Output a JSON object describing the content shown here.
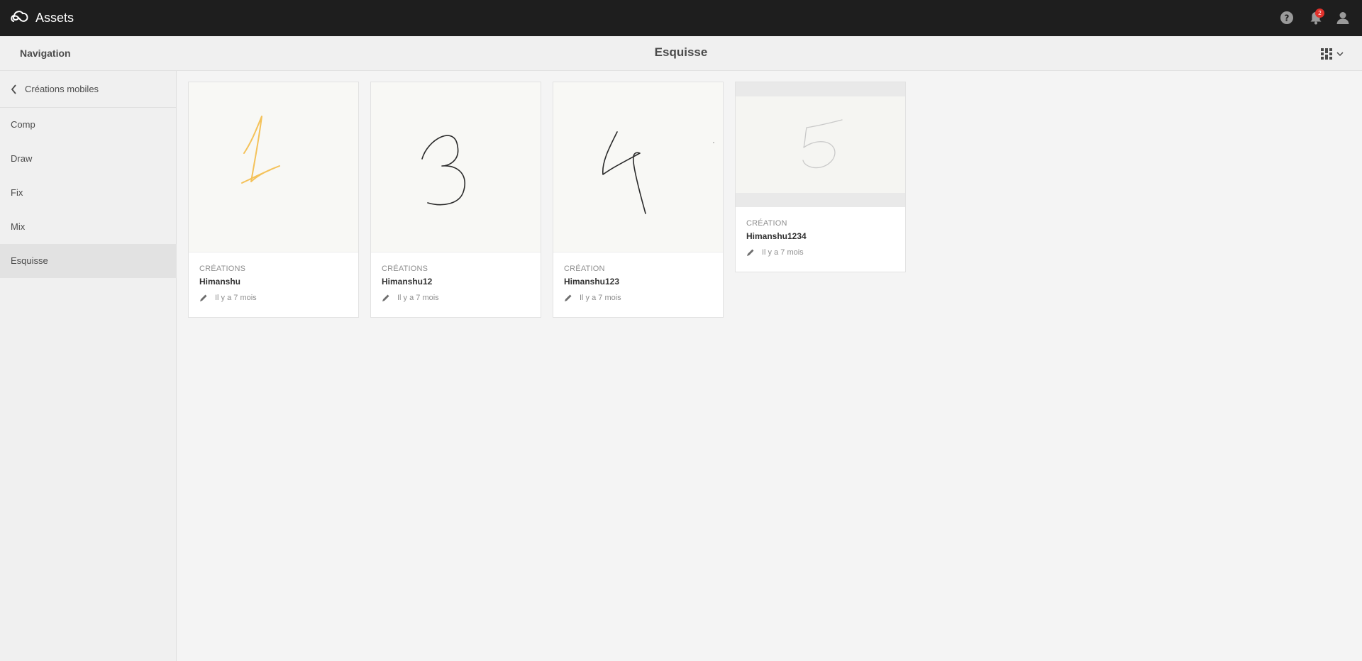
{
  "app": {
    "title": "Assets",
    "notification_count": "2"
  },
  "header": {
    "nav_title": "Navigation",
    "page_title": "Esquisse"
  },
  "sidebar": {
    "back_label": "Créations mobiles",
    "items": [
      {
        "label": "Comp"
      },
      {
        "label": "Draw"
      },
      {
        "label": "Fix"
      },
      {
        "label": "Mix"
      },
      {
        "label": "Esquisse",
        "active": true
      }
    ]
  },
  "cards": [
    {
      "kind": "CRÉATIONS",
      "name": "Himanshu",
      "time": "Il y a 7 mois",
      "sketch": "1",
      "stroke_color": "#f4c25a"
    },
    {
      "kind": "CRÉATIONS",
      "name": "Himanshu12",
      "time": "Il y a 7 mois",
      "sketch": "3",
      "stroke_color": "#2a2a2a"
    },
    {
      "kind": "CRÉATION",
      "name": "Himanshu123",
      "time": "Il y a 7 mois",
      "sketch": "4",
      "stroke_color": "#2a2a2a"
    },
    {
      "kind": "CRÉATION",
      "name": "Himanshu1234",
      "time": "Il y a 7 mois",
      "sketch": "5",
      "stroke_color": "#c9c9c9"
    }
  ],
  "icons": {
    "logo": "creative-cloud-icon",
    "help": "help-icon",
    "bell": "bell-icon",
    "user": "user-icon",
    "view": "grid-view-icon",
    "back": "chevron-left-icon",
    "edit": "pencil-icon"
  }
}
